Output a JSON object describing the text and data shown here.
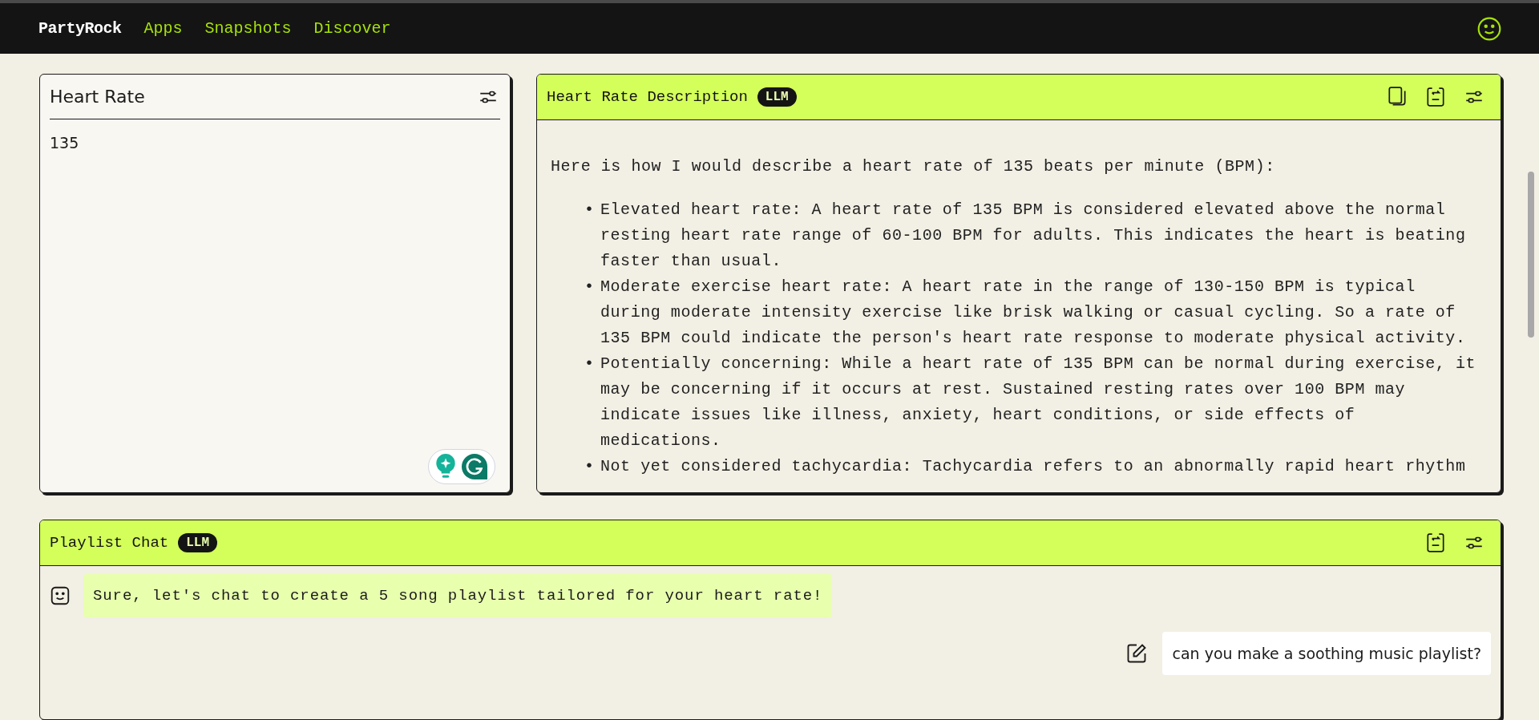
{
  "nav": {
    "brand": "PartyRock",
    "links": [
      "Apps",
      "Snapshots",
      "Discover"
    ]
  },
  "widgets": [
    {
      "kind": "input",
      "title": "Heart Rate",
      "value": "135"
    },
    {
      "kind": "llm_text",
      "title": "Heart Rate Description",
      "badge": "LLM",
      "intro": "Here is how I would describe a heart rate of 135 beats per minute (BPM):",
      "bullets": [
        {
          "marker": "•",
          "text": "Elevated heart rate: A heart rate of 135 BPM is considered elevated above the normal resting heart rate range of 60-100 BPM for adults. This indicates the heart is beating faster than usual."
        },
        {
          "marker": "•",
          "text": "Moderate exercise heart rate: A heart rate in the range of 130-150 BPM is typical during moderate intensity exercise like brisk walking or casual cycling. So a rate of 135 BPM could indicate the person's heart rate response to moderate physical activity."
        },
        {
          "marker": "•",
          "text": "Potentially concerning: While a heart rate of 135 BPM can be normal during exercise, it may be concerning if it occurs at rest. Sustained resting rates over 100 BPM may indicate issues like illness, anxiety, heart conditions, or side effects of medications."
        },
        {
          "marker": "•",
          "text": "Not yet considered tachycardia: Tachycardia refers to an abnormally rapid heart rhythm"
        }
      ]
    },
    {
      "kind": "llm_chat",
      "title": "Playlist Chat",
      "badge": "LLM",
      "messages": [
        {
          "kind": "assistant",
          "text": "Sure, let's chat to create a 5 song playlist tailored for your heart rate!"
        },
        {
          "kind": "user",
          "text": "can you make a soothing music playlist?"
        }
      ]
    }
  ]
}
